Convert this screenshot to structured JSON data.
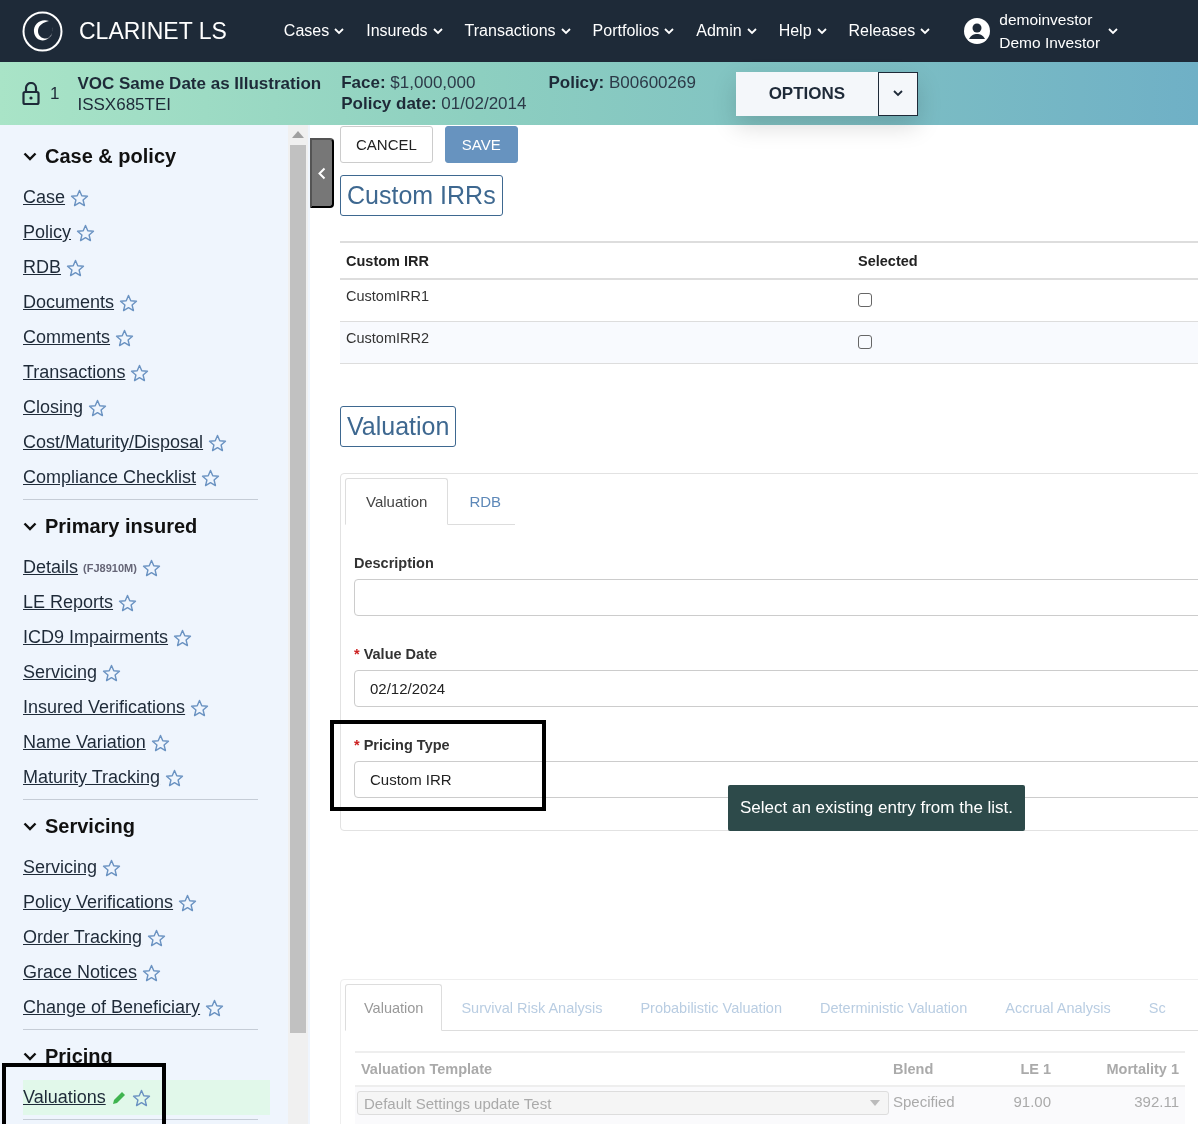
{
  "top_nav": {
    "brand": "CLARINET LS",
    "menus": [
      "Cases",
      "Insureds",
      "Transactions",
      "Portfolios",
      "Admin",
      "Help",
      "Releases"
    ],
    "user": {
      "username": "demoinvestor",
      "full_name": "Demo Investor"
    }
  },
  "case_bar": {
    "lock_count": "1",
    "title": "VOC Same Date as Illustration",
    "code": "ISSX685TEI",
    "fields": [
      {
        "label": "Face:",
        "value": "$1,000,000"
      },
      {
        "label": "Policy date:",
        "value": "01/02/2014"
      },
      {
        "label": "Policy:",
        "value": "B00600269"
      }
    ],
    "options_button": "OPTIONS"
  },
  "sidebar": {
    "sections": [
      {
        "title": "Case & policy",
        "expanded": true,
        "items": [
          {
            "label": "Case",
            "selected": false,
            "favorite": false
          },
          {
            "label": "Policy",
            "selected": false,
            "favorite": false
          },
          {
            "label": "RDB",
            "selected": false,
            "favorite": false
          },
          {
            "label": "Documents",
            "selected": false,
            "favorite": false
          },
          {
            "label": "Comments",
            "selected": false,
            "favorite": false
          },
          {
            "label": "Transactions",
            "selected": false,
            "favorite": false
          },
          {
            "label": "Closing",
            "selected": false,
            "favorite": false
          },
          {
            "label": "Cost/Maturity/Disposal",
            "selected": false,
            "favorite": false
          },
          {
            "label": "Compliance Checklist",
            "selected": false,
            "favorite": false
          }
        ]
      },
      {
        "title": "Primary insured",
        "expanded": true,
        "items": [
          {
            "label": "Details",
            "note": "(FJ8910M)",
            "selected": false,
            "favorite": false
          },
          {
            "label": "LE Reports",
            "selected": false,
            "favorite": false
          },
          {
            "label": "ICD9 Impairments",
            "selected": false,
            "favorite": false
          },
          {
            "label": "Servicing",
            "selected": false,
            "favorite": false
          },
          {
            "label": "Insured Verifications",
            "selected": false,
            "favorite": false
          },
          {
            "label": "Name Variation",
            "selected": false,
            "favorite": false
          },
          {
            "label": "Maturity Tracking",
            "selected": false,
            "favorite": false
          }
        ]
      },
      {
        "title": "Servicing",
        "expanded": true,
        "items": [
          {
            "label": "Servicing",
            "selected": false,
            "favorite": false
          },
          {
            "label": "Policy Verifications",
            "selected": false,
            "favorite": false
          },
          {
            "label": "Order Tracking",
            "selected": false,
            "favorite": false
          },
          {
            "label": "Grace Notices",
            "selected": false,
            "favorite": false
          },
          {
            "label": "Change of Beneficiary",
            "selected": false,
            "favorite": false
          }
        ]
      },
      {
        "title": "Pricing",
        "expanded": true,
        "items": [
          {
            "label": "Valuations",
            "selected": true,
            "editing": true,
            "highlighted": true,
            "favorite": false
          }
        ]
      }
    ]
  },
  "actions": [
    {
      "label": "CANCEL",
      "kind": "secondary"
    },
    {
      "label": "SAVE",
      "kind": "primary"
    }
  ],
  "custom_irrs": {
    "heading": "Custom IRRs",
    "columns": [
      "Custom IRR",
      "Selected"
    ],
    "rows": [
      {
        "name": "CustomIRR1",
        "checked": false
      },
      {
        "name": "CustomIRR2",
        "checked": false
      }
    ]
  },
  "valuation": {
    "heading": "Valuation",
    "tabs": [
      {
        "label": "Valuation",
        "selected": true
      },
      {
        "label": "RDB",
        "selected": false
      }
    ],
    "fields": [
      {
        "label": "Description"
      },
      {
        "label": "Value Date",
        "required_mark": "*",
        "value": "02/12/2024"
      },
      {
        "label": "Pricing Type",
        "required_mark": "*",
        "value": "Custom IRR",
        "highlighted": true
      }
    ],
    "tooltip": "Select an existing entry from the list."
  },
  "results": {
    "disabled": true,
    "tabs": [
      {
        "label": "Valuation",
        "selected": true
      },
      {
        "label": "Survival Risk Analysis",
        "selected": false
      },
      {
        "label": "Probabilistic Valuation",
        "selected": false
      },
      {
        "label": "Deterministic Valuation",
        "selected": false
      },
      {
        "label": "Accrual Analysis",
        "selected": false
      },
      {
        "label": "Sc",
        "selected": false
      }
    ],
    "columns": [
      "Valuation Template",
      "Blend",
      "LE 1",
      "Mortality 1"
    ],
    "rows": [
      {
        "template": "Default Settings update Test",
        "blend": "Specified",
        "le_1": "91.00",
        "mortality_1": "392.11"
      }
    ]
  }
}
